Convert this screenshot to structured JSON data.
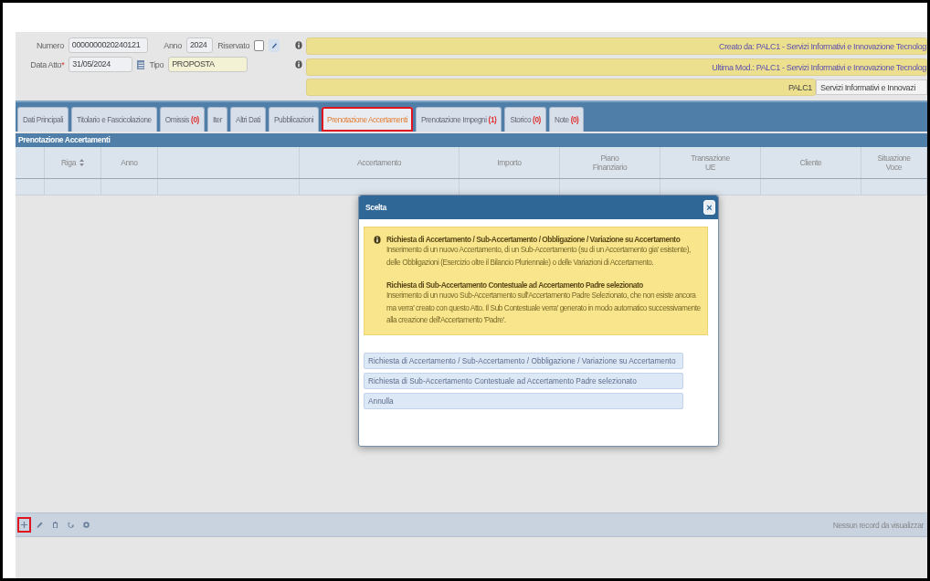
{
  "header": {
    "numero": {
      "label": "Numero",
      "value": "0000000020240121"
    },
    "anno": {
      "label": "Anno",
      "value": "2024"
    },
    "riservato": {
      "label": "Riservato",
      "checked": false
    },
    "data_atto": {
      "label": "Data Atto",
      "required_mark": "*",
      "value": "31/05/2024"
    },
    "tipo": {
      "label": "Tipo",
      "value": "PROPOSTA"
    },
    "info_lines": [
      "Creato da: PALC1 - Servizi Informativi e Innovazione Tecnolog",
      "Ultima Mod.: PALC1 - Servizi Informativi e Innovazione Tecnolog"
    ],
    "ufficio": {
      "code": "PALC1",
      "value": "Servizi Informativi e Innovazi"
    }
  },
  "tabs": [
    {
      "label": "Dati Principali",
      "selected": false,
      "highlighted": false
    },
    {
      "label": "Titolario e Fascicolazione",
      "selected": false,
      "highlighted": false
    },
    {
      "label": "Omissis",
      "count": "(0)",
      "selected": false,
      "highlighted": false
    },
    {
      "label": "Iter",
      "selected": false,
      "highlighted": false
    },
    {
      "label": "Altri Dati",
      "selected": false,
      "highlighted": false
    },
    {
      "label": "Pubblicazioni",
      "selected": false,
      "highlighted": false
    },
    {
      "label": "Prenotazione Accertamenti",
      "selected": true,
      "highlighted": true
    },
    {
      "label": "Prenotazione Impegni",
      "count": "(1)",
      "selected": false,
      "highlighted": false
    },
    {
      "label": "Storico",
      "count": "(0)",
      "selected": false,
      "highlighted": false
    },
    {
      "label": "Note",
      "count": "(0)",
      "selected": false,
      "highlighted": false
    }
  ],
  "panel": {
    "title": "Prenotazione Accertamenti",
    "columns": [
      {},
      {
        "label": "Riga",
        "sortable": true
      },
      {
        "label": "Anno"
      },
      {},
      {
        "label": "Accertamento"
      },
      {
        "label": "Importo"
      },
      {
        "label": "Piano Finanziario"
      },
      {
        "label": "Transazione UE"
      },
      {
        "label": "Cliente"
      },
      {
        "label": "Situazione Voce"
      }
    ]
  },
  "dialog": {
    "title": "Scelta",
    "close": "×",
    "info": [
      {
        "heading": "Richiesta di Accertamento / Sub-Accertamento / Obbligazione / Variazione su Accertamento",
        "text": "Inserimento di un nuovo Accertamento, di un Sub-Accertamento (su di un Accertamento gia' esistente),  delle Obbligazioni (Esercizio oltre il Bilancio Pluriennale) o delle Variazioni di Accertamento."
      },
      {
        "heading": "Richiesta di Sub-Accertamento Contestuale ad Accertamento Padre selezionato",
        "text": "Inserimento di un nuovo Sub-Accertamento sull'Accertamento Padre Selezionato, che non esiste ancora ma verra' creato con questo Atto. Il Sub Contestuale verra' generato in modo automatico successivamente alla creazione dell'Accertamento 'Padre'."
      }
    ],
    "options": [
      "Richiesta di Accertamento / Sub-Accertamento / Obbligazione / Variazione su Accertamento",
      "Richiesta di Sub-Accertamento Contestuale ad Accertamento Padre selezionato",
      "Annulla"
    ]
  },
  "toolbar": {
    "tools": [
      {
        "kind": "add",
        "highlighted": true
      },
      {
        "kind": "edit",
        "highlighted": false
      },
      {
        "kind": "delete",
        "highlighted": false
      },
      {
        "kind": "refresh",
        "highlighted": false
      },
      {
        "kind": "settings",
        "highlighted": false
      }
    ],
    "status": "Nessun record da visualizzar"
  }
}
